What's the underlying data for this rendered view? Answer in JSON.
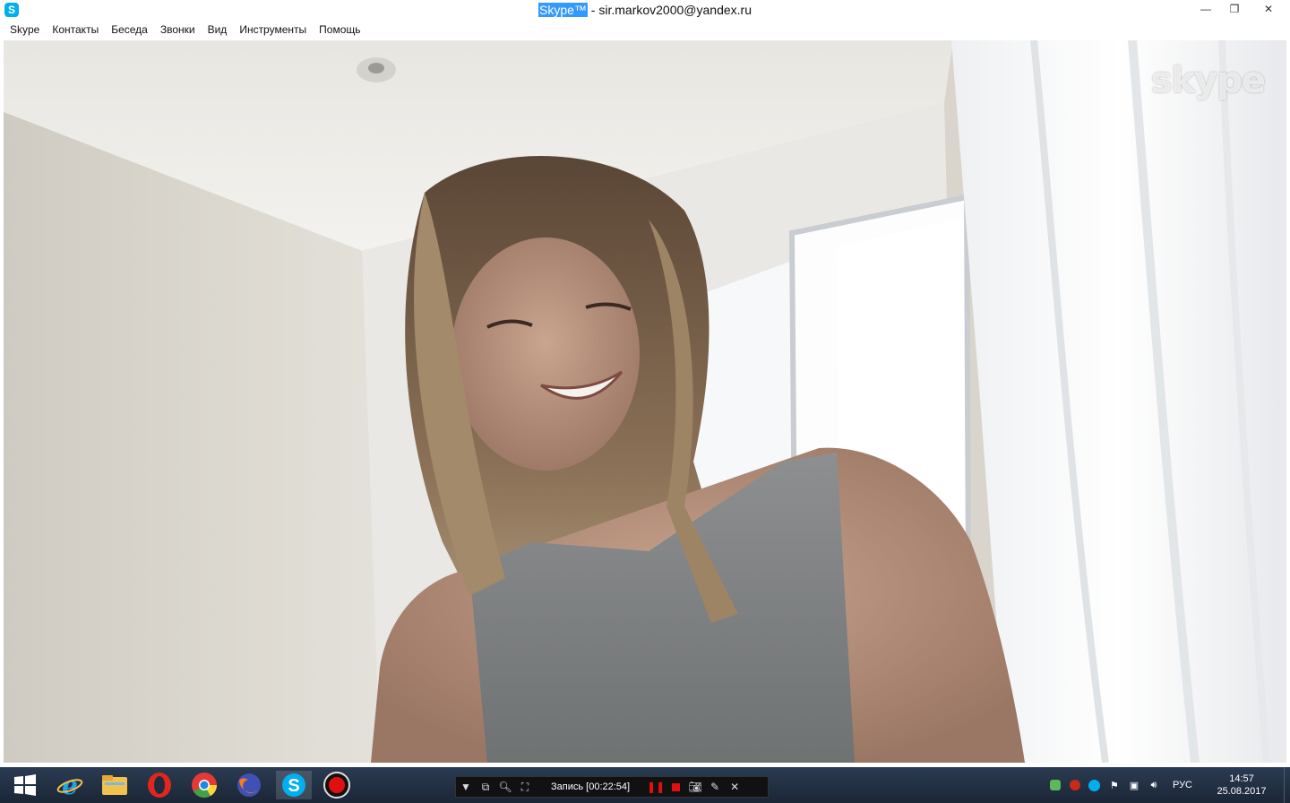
{
  "window": {
    "title_highlight": "Skype™",
    "title_rest": " - sir.markov2000@yandex.ru",
    "app_icon": "skype-icon",
    "controls": {
      "minimize": "—",
      "restore": "❐",
      "close": "✕"
    }
  },
  "menu": {
    "items": [
      "Skype",
      "Контакты",
      "Беседа",
      "Звонки",
      "Вид",
      "Инструменты",
      "Помощь"
    ]
  },
  "video": {
    "watermark": "skype",
    "description_icon": "video-feed"
  },
  "taskbar": {
    "apps": [
      {
        "name": "windows-start-icon",
        "color": "#ffffff"
      },
      {
        "name": "internet-explorer-icon",
        "color": "#1fa3e6"
      },
      {
        "name": "file-explorer-icon",
        "color": "#f2c14e"
      },
      {
        "name": "opera-icon",
        "color": "#e0261d"
      },
      {
        "name": "chrome-icon",
        "color": "#4caf50"
      },
      {
        "name": "firefox-icon",
        "color": "#ff7a1a"
      },
      {
        "name": "skype-icon",
        "color": "#00aff0"
      },
      {
        "name": "record-app-icon",
        "color": "#e01010"
      }
    ],
    "recorder": {
      "status": "Запись [00:22:54]"
    },
    "tray": {
      "language": "РУС",
      "time": "14:57",
      "date": "25.08.2017"
    }
  },
  "colors": {
    "accent": "#00aff0",
    "taskbar": "#1f2c3f",
    "highlight": "#3399ff"
  }
}
